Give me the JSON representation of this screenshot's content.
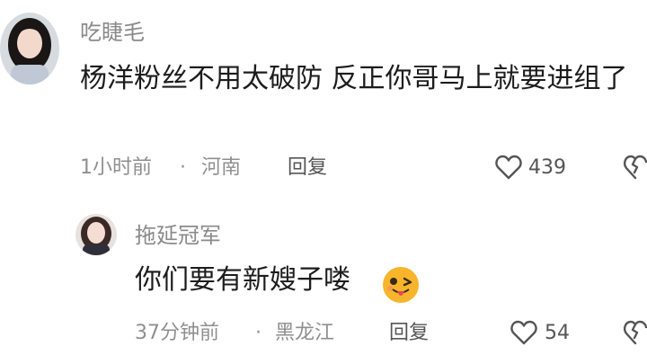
{
  "comments": [
    {
      "author": "吃睫毛",
      "content": "杨洋粉丝不用太破防 反正你哥马上就要进组了",
      "time": "1小时前",
      "separator": "·",
      "location": "河南",
      "reply_label": "回复",
      "likes": "439",
      "avatar_icon": "user-avatar-photo"
    },
    {
      "author": "拖延冠军",
      "content": "你们要有新嫂子喽",
      "emoji": "wink-tongue-emoji",
      "time": "37分钟前",
      "separator": "·",
      "location": "黑龙江",
      "reply_label": "回复",
      "likes": "54",
      "avatar_icon": "user-avatar-photo"
    }
  ],
  "icons": {
    "like": "heart-icon",
    "dislike": "broken-heart-icon"
  },
  "colors": {
    "author": "#8a8a8a",
    "content": "#1c1c1c",
    "meta": "#8f8f8f",
    "action": "#555555",
    "emoji": "#f7b52c"
  }
}
